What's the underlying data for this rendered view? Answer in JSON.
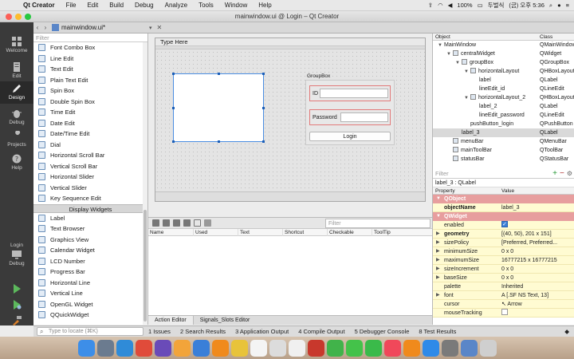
{
  "mac_menubar": {
    "app_name": "Qt Creator",
    "menus": [
      "File",
      "Edit",
      "Build",
      "Debug",
      "Analyze",
      "Tools",
      "Window",
      "Help"
    ],
    "battery": "100%",
    "input_source": "두벌식",
    "clock": "(금) 오후 5:36"
  },
  "window": {
    "title": "mainwindow.ui @ Login – Qt Creator",
    "file_tab": "mainwindow.ui*"
  },
  "modes": [
    {
      "label": "Welcome",
      "icon": "grid-icon"
    },
    {
      "label": "Edit",
      "icon": "document-icon"
    },
    {
      "label": "Design",
      "icon": "pencil-icon"
    },
    {
      "label": "Debug",
      "icon": "bug-icon"
    },
    {
      "label": "Projects",
      "icon": "wrench-icon"
    },
    {
      "label": "Help",
      "icon": "question-icon"
    }
  ],
  "kit_selector": {
    "project": "Login",
    "config": "Debug"
  },
  "widget_box": {
    "filter_placeholder": "Filter",
    "input_widgets": [
      "Font Combo Box",
      "Line Edit",
      "Text Edit",
      "Plain Text Edit",
      "Spin Box",
      "Double Spin Box",
      "Time Edit",
      "Date Edit",
      "Date/Time Edit",
      "Dial",
      "Horizontal Scroll Bar",
      "Vertical Scroll Bar",
      "Horizontal Slider",
      "Vertical Slider",
      "Key Sequence Edit"
    ],
    "display_category": "Display Widgets",
    "display_widgets": [
      "Label",
      "Text Browser",
      "Graphics View",
      "Calendar Widget",
      "LCD Number",
      "Progress Bar",
      "Horizontal Line",
      "Vertical Line",
      "OpenGL Widget",
      "QQuickWidget"
    ]
  },
  "form": {
    "menu_placeholder": "Type Here",
    "groupbox_title": "GroupBox",
    "id_label": "ID",
    "password_label": "Password",
    "login_button": "Login"
  },
  "action_editor": {
    "filter_placeholder": "Filter",
    "columns": [
      "Name",
      "Used",
      "Text",
      "Shortcut",
      "Checkable",
      "ToolTip"
    ],
    "tabs": [
      "Action Editor",
      "Signals_Slots Editor"
    ]
  },
  "object_inspector": {
    "headers": {
      "object": "Object",
      "class": "Class"
    },
    "rows": [
      {
        "name": "MainWindow",
        "cls": "QMainWindow",
        "depth": 0,
        "expanded": true
      },
      {
        "name": "centralWidget",
        "cls": "QWidget",
        "depth": 1,
        "expanded": true
      },
      {
        "name": "groupBox",
        "cls": "QGroupBox",
        "depth": 2,
        "expanded": true
      },
      {
        "name": "horizontalLayout",
        "cls": "QHBoxLayout",
        "depth": 3,
        "expanded": true
      },
      {
        "name": "label",
        "cls": "QLabel",
        "depth": 4
      },
      {
        "name": "lineEdit_id",
        "cls": "QLineEdit",
        "depth": 4
      },
      {
        "name": "horizontalLayout_2",
        "cls": "QHBoxLayout",
        "depth": 3,
        "expanded": true
      },
      {
        "name": "label_2",
        "cls": "QLabel",
        "depth": 4
      },
      {
        "name": "lineEdit_password",
        "cls": "QLineEdit",
        "depth": 4
      },
      {
        "name": "pushButton_login",
        "cls": "QPushButton",
        "depth": 3
      },
      {
        "name": "label_3",
        "cls": "QLabel",
        "depth": 2,
        "selected": true
      },
      {
        "name": "menuBar",
        "cls": "QMenuBar",
        "depth": 1
      },
      {
        "name": "mainToolBar",
        "cls": "QToolBar",
        "depth": 1
      },
      {
        "name": "statusBar",
        "cls": "QStatusBar",
        "depth": 1
      }
    ]
  },
  "property_editor": {
    "filter_placeholder": "Filter",
    "title": "label_3 : QLabel",
    "headers": {
      "property": "Property",
      "value": "Value"
    },
    "rows": [
      {
        "kind": "group",
        "name": "QObject"
      },
      {
        "name": "objectName",
        "value": "label_3",
        "bold": true
      },
      {
        "kind": "group",
        "name": "QWidget"
      },
      {
        "name": "enabled",
        "checkbox": true
      },
      {
        "name": "geometry",
        "value": "[(40, 50), 201 x 151]",
        "bold": true,
        "expandable": true
      },
      {
        "name": "sizePolicy",
        "value": "[Preferred, Preferred...",
        "expandable": true
      },
      {
        "name": "minimumSize",
        "value": "0 x 0",
        "expandable": true
      },
      {
        "name": "maximumSize",
        "value": "16777215 x 16777215",
        "expandable": true
      },
      {
        "name": "sizeIncrement",
        "value": "0 x 0",
        "expandable": true
      },
      {
        "name": "baseSize",
        "value": "0 x 0",
        "expandable": true
      },
      {
        "name": "palette",
        "value": "Inherited"
      },
      {
        "name": "font",
        "value": "A  [.SF NS Text, 13]",
        "expandable": true
      },
      {
        "name": "cursor",
        "value": "↖  Arrow"
      },
      {
        "name": "mouseTracking",
        "checkbox": false
      }
    ]
  },
  "output_bar": {
    "locator_placeholder": "Type to locate (⌘K)",
    "tabs": [
      "1  Issues",
      "2  Search Results",
      "3  Application Output",
      "4  Compile Output",
      "5  Debugger Console",
      "8  Test Results"
    ]
  },
  "dock": {
    "apps": [
      {
        "name": "Finder",
        "color": "#3d8ee8"
      },
      {
        "name": "Launchpad",
        "color": "#6b7b8f"
      },
      {
        "name": "Safari",
        "color": "#2f8bd8"
      },
      {
        "name": "Chrome",
        "color": "#e04b3a"
      },
      {
        "name": "iMovie",
        "color": "#6a4bb8"
      },
      {
        "name": "Photos",
        "color": "#f2a43a"
      },
      {
        "name": "Keynote",
        "color": "#3a7fd8"
      },
      {
        "name": "VLC",
        "color": "#f08a1c"
      },
      {
        "name": "Notes",
        "color": "#e8c33a"
      },
      {
        "name": "Calendar",
        "color": "#f4f4f4"
      },
      {
        "name": "TextEdit",
        "color": "#dcdcdc"
      },
      {
        "name": "Reminders",
        "color": "#f0f0f0"
      },
      {
        "name": "Photo Booth",
        "color": "#c8382c"
      },
      {
        "name": "Qt Creator",
        "color": "#41b34a"
      },
      {
        "name": "Messages",
        "color": "#44c24a"
      },
      {
        "name": "FaceTime",
        "color": "#3aba4a"
      },
      {
        "name": "Music",
        "color": "#f0485a"
      },
      {
        "name": "Books",
        "color": "#f08a1c"
      },
      {
        "name": "App Store",
        "color": "#2e8ae8"
      },
      {
        "name": "System Preferences",
        "color": "#7a7a7a"
      },
      {
        "name": "Downloads",
        "color": "#5a86c8"
      },
      {
        "name": "Trash",
        "color": "#cfcfcf"
      }
    ]
  }
}
